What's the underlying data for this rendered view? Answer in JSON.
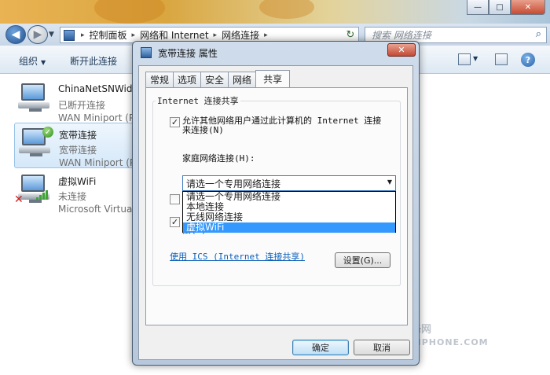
{
  "explorer": {
    "window_buttons": {
      "minimize": "—",
      "maximize": "□",
      "close": "✕"
    },
    "breadcrumbs": [
      "控制面板",
      "网络和 Internet",
      "网络连接"
    ],
    "search_placeholder": "搜索 网络连接",
    "toolbar": {
      "organize": "组织",
      "disconnect": "断开此连接"
    },
    "connections": [
      {
        "name": "ChinaNetSNWide",
        "status": "已断开连接",
        "device": "WAN Miniport (PPPOE)"
      },
      {
        "name": "宽带连接",
        "status": "宽带连接",
        "device": "WAN Miniport (PPPOE)"
      },
      {
        "name": "虚拟WiFi",
        "status": "未连接",
        "device": "Microsoft Virtual WiFi Miniport Adapter"
      }
    ]
  },
  "dialog": {
    "title": "宽带连接 属性",
    "close_label": "✕",
    "tabs": [
      "常规",
      "选项",
      "安全",
      "网络",
      "共享"
    ],
    "active_tab": "共享",
    "group_title": "Internet 连接共享",
    "allow_share": {
      "checked": true,
      "line1": "允许其他网络用户通过此计算机的 Internet 连接",
      "line2": "来连接(N)"
    },
    "home_network_label": "家庭网络连接(H):",
    "home_network_selected": "请选一个专用网络连接",
    "home_network_options": [
      "请选一个专用网络连接",
      "本地连接",
      "无线网络连接",
      "虚拟WiFi"
    ],
    "home_network_highlighted": "虚拟WiFi",
    "dial_checkbox": {
      "checked": false
    },
    "allow_control": {
      "checked": true,
      "line1_visible": "连接",
      "line2": "接(O)"
    },
    "ics_link": "使用 ICS (Internet 连接共享)",
    "settings_button": "设置(G)...",
    "ok_button": "确定",
    "cancel_button": "取消"
  },
  "watermark": {
    "top": "威锋网",
    "bottom": "WEIPHONE.COM"
  }
}
